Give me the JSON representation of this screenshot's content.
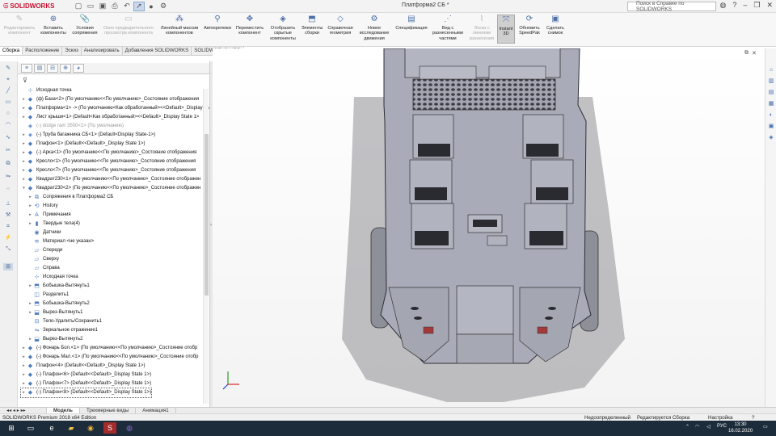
{
  "app": {
    "logo_text": "SOLIDWORKS",
    "document_title": "Платформа2 СБ *",
    "help_search_placeholder": "Поиск в Справке по SOLIDWORKS"
  },
  "ribbon": {
    "buttons": [
      {
        "label": "Редактировать компонент",
        "enabled": false
      },
      {
        "label": "Вставить компоненты",
        "enabled": true
      },
      {
        "label": "Условия сопряжения",
        "enabled": true
      },
      {
        "label": "Окно предварительного просмотра компонента",
        "enabled": false
      },
      {
        "label": "Линейный массив компонентов",
        "enabled": true
      },
      {
        "label": "Автокрепежи",
        "enabled": true
      },
      {
        "label": "Переместить компонент",
        "enabled": true
      },
      {
        "label": "Отобразить скрытые компоненты",
        "enabled": true
      },
      {
        "label": "Элементы сборки",
        "enabled": true
      },
      {
        "label": "Справочная геометрия",
        "enabled": true
      },
      {
        "label": "Новое исследование движения",
        "enabled": true
      },
      {
        "label": "Спецификация",
        "enabled": true
      },
      {
        "label": "Вид с разнесенными частями",
        "enabled": true
      },
      {
        "label": "Эскиз с линиями разнесения",
        "enabled": false
      },
      {
        "label": "Instant 3D",
        "enabled": true
      },
      {
        "label": "Обновить SpeedPak",
        "enabled": true
      },
      {
        "label": "Сделать снимок",
        "enabled": true
      }
    ]
  },
  "command_tabs": [
    "Сборка",
    "Расположение",
    "Эскиз",
    "Анализировать",
    "Добавления SOLIDWORKS",
    "SOLIDWORKS MBD"
  ],
  "tree": {
    "items": [
      {
        "label": "Исходная точка",
        "indent": 0,
        "toggle": "",
        "icon": "origin-icon",
        "state": "normal"
      },
      {
        "label": "(ф) База<2> (По умолчанию<<По умолчанию>_Состояние отображения",
        "indent": 0,
        "toggle": "▸",
        "icon": "part-icon",
        "state": "normal"
      },
      {
        "label": "Платформа<1> -> (По умолчанию<Как обработанный><<Default>_Display State 1",
        "indent": 0,
        "toggle": "▸",
        "icon": "part-icon",
        "state": "normal"
      },
      {
        "label": "Лист крыши<1> (Default<Как обработанный><<Default>_Display State 1>",
        "indent": 0,
        "toggle": "▸",
        "icon": "part-icon",
        "state": "normal"
      },
      {
        "label": "(-) dodge ram 3500<1> (По умолчанию)",
        "indent": 0,
        "toggle": "",
        "icon": "assembly-icon",
        "state": "grey"
      },
      {
        "label": "(-) Труба багажника СБ<1> (Default<Display State-1>)",
        "indent": 0,
        "toggle": "▸",
        "icon": "assembly-icon",
        "state": "normal"
      },
      {
        "label": "Плафон<1> (Default<<Default>_Display State 1>)",
        "indent": 0,
        "toggle": "▸",
        "icon": "part-icon",
        "state": "normal"
      },
      {
        "label": "(-) Арка<1> (По умолчанию<<По умолчанию>_Состояние отображения",
        "indent": 0,
        "toggle": "▸",
        "icon": "part-icon",
        "state": "normal"
      },
      {
        "label": "Кресло<1> (По умолчанию<<По умолчанию>_Состояние отображения",
        "indent": 0,
        "toggle": "▸",
        "icon": "part-icon",
        "state": "normal"
      },
      {
        "label": "Кресло<7> (По умолчанию<<По умолчанию>_Состояние отображения",
        "indent": 0,
        "toggle": "▸",
        "icon": "part-icon",
        "state": "normal"
      },
      {
        "label": "Квадрат230<1> (По умолчанию<<По умолчанию>_Состояние отображен",
        "indent": 0,
        "toggle": "▸",
        "icon": "part-icon",
        "state": "normal"
      },
      {
        "label": "Квадрат230<2> (По умолчанию<<По умолчанию>_Состояние отображен",
        "indent": 0,
        "toggle": "▾",
        "icon": "part-icon",
        "state": "normal"
      },
      {
        "label": "Сопряжения в Платформа2 СБ",
        "indent": 1,
        "toggle": "▸",
        "icon": "mates-icon",
        "state": "normal"
      },
      {
        "label": "History",
        "indent": 1,
        "toggle": "▸",
        "icon": "history-icon",
        "state": "normal"
      },
      {
        "label": "Примечания",
        "indent": 1,
        "toggle": "▸",
        "icon": "annotations-icon",
        "state": "normal"
      },
      {
        "label": "Твердые тела(4)",
        "indent": 1,
        "toggle": "▸",
        "icon": "solid-bodies-icon",
        "state": "normal"
      },
      {
        "label": "Датчики",
        "indent": 1,
        "toggle": "",
        "icon": "sensor-icon",
        "state": "normal"
      },
      {
        "label": "Материал <не указан>",
        "indent": 1,
        "toggle": "",
        "icon": "material-icon",
        "state": "normal"
      },
      {
        "label": "Спереди",
        "indent": 1,
        "toggle": "",
        "icon": "plane-icon",
        "state": "normal"
      },
      {
        "label": "Сверху",
        "indent": 1,
        "toggle": "",
        "icon": "plane-icon",
        "state": "normal"
      },
      {
        "label": "Справа",
        "indent": 1,
        "toggle": "",
        "icon": "plane-icon",
        "state": "normal"
      },
      {
        "label": "Исходная точка",
        "indent": 1,
        "toggle": "",
        "icon": "origin-icon",
        "state": "normal"
      },
      {
        "label": "Бобышка-Вытянуть1",
        "indent": 1,
        "toggle": "▸",
        "icon": "extrude-icon",
        "state": "normal"
      },
      {
        "label": "Разделить1",
        "indent": 1,
        "toggle": "",
        "icon": "split-icon",
        "state": "normal"
      },
      {
        "label": "Бобышка-Вытянуть2",
        "indent": 1,
        "toggle": "▸",
        "icon": "extrude-icon",
        "state": "normal"
      },
      {
        "label": "Вырез-Вытянуть1",
        "indent": 1,
        "toggle": "▸",
        "icon": "cut-icon",
        "state": "normal"
      },
      {
        "label": "Тело-Удалить/Сохранить1",
        "indent": 1,
        "toggle": "",
        "icon": "body-delete-icon",
        "state": "normal"
      },
      {
        "label": "Зеркальное отражение1",
        "indent": 1,
        "toggle": "",
        "icon": "mirror-icon",
        "state": "normal"
      },
      {
        "label": "Вырез-Вытянуть2",
        "indent": 1,
        "toggle": "▸",
        "icon": "cut-icon",
        "state": "normal"
      },
      {
        "label": "(-) Фонарь Бол.<1> (По умолчанию<<По умолчанию>_Состояние отобр",
        "indent": 0,
        "toggle": "▸",
        "icon": "part-icon",
        "state": "normal"
      },
      {
        "label": "(-) Фонарь Мал.<1> (По умолчанию<<По умолчанию>_Состояние отобр",
        "indent": 0,
        "toggle": "▸",
        "icon": "part-icon",
        "state": "normal"
      },
      {
        "label": "Плафон<4> (Default<<Default>_Display State 1>)",
        "indent": 0,
        "toggle": "▸",
        "icon": "part-icon",
        "state": "normal"
      },
      {
        "label": "(-) Плафон<6> (Default<<Default>_Display State 1>)",
        "indent": 0,
        "toggle": "▸",
        "icon": "part-icon",
        "state": "normal"
      },
      {
        "label": "(-) Плафон<7> (Default<<Default>_Display State 1>)",
        "indent": 0,
        "toggle": "▸",
        "icon": "part-icon",
        "state": "normal"
      },
      {
        "label": "(-) Плафон<8> (Default<<Default>_Display State 1>)",
        "indent": 0,
        "toggle": "▸",
        "icon": "part-icon",
        "state": "selected"
      }
    ]
  },
  "bottom_tabs": [
    "Модель",
    "Трехмерные виды",
    "Анимация1"
  ],
  "status": {
    "edition": "SOLIDWORKS Premium 2018 x64 Edition",
    "definition": "Недоопределенный",
    "editing": "Редактируется Сборка",
    "settings": "Настройка"
  },
  "taskbar": {
    "language": "РУС",
    "time": "13:30",
    "date": "16.02.2020"
  },
  "colors": {
    "logo_red": "#c8102e",
    "model_body": "#a9abb8",
    "model_shadow": "#9a9aa1"
  }
}
